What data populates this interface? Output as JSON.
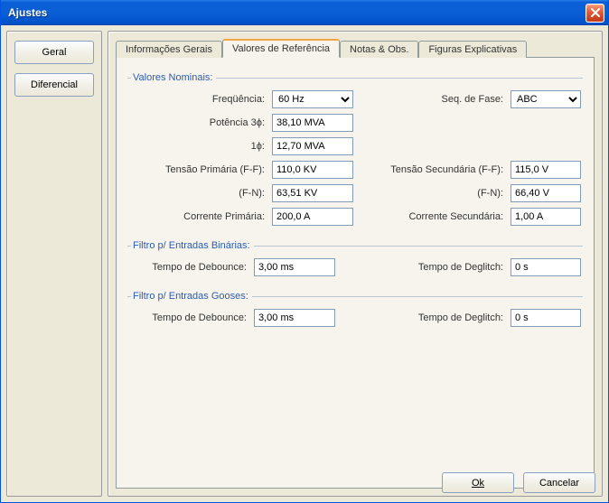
{
  "window": {
    "title": "Ajustes"
  },
  "nav": {
    "geral": "Geral",
    "diferencial": "Diferencial"
  },
  "tabs": {
    "info": "Informações Gerais",
    "valores": "Valores de Referência",
    "notas": "Notas & Obs.",
    "figuras": "Figuras Explicativas"
  },
  "groups": {
    "nominais": "Valores Nominais:",
    "binarias": "Filtro p/ Entradas Binárias:",
    "gooses": "Filtro p/ Entradas Gooses:"
  },
  "labels": {
    "freq": "Freqüência:",
    "seqfase": "Seq. de Fase:",
    "pot3": "Potência 3ϕ:",
    "pot1": "1ϕ:",
    "tensprim": "Tensão Primária (F-F):",
    "tenssec": "Tensão Secundária (F-F):",
    "fn": "(F-N):",
    "corrprim": "Corrente Primária:",
    "corrsec": "Corrente Secundária:",
    "debounce": "Tempo de Debounce:",
    "deglitch": "Tempo de Deglitch:"
  },
  "values": {
    "freq": "60 Hz",
    "seqfase": "ABC",
    "pot3": "38,10 MVA",
    "pot1": "12,70 MVA",
    "tensprim_ff": "110,0 KV",
    "tensprim_fn": "63,51 KV",
    "tenssec_ff": "115,0 V",
    "tenssec_fn": "66,40 V",
    "corrprim": "200,0 A",
    "corrsec": "1,00 A",
    "bin_debounce": "3,00 ms",
    "bin_deglitch": "0 s",
    "goose_debounce": "3,00 ms",
    "goose_deglitch": "0 s"
  },
  "buttons": {
    "ok": "Ok",
    "cancel": "Cancelar"
  }
}
